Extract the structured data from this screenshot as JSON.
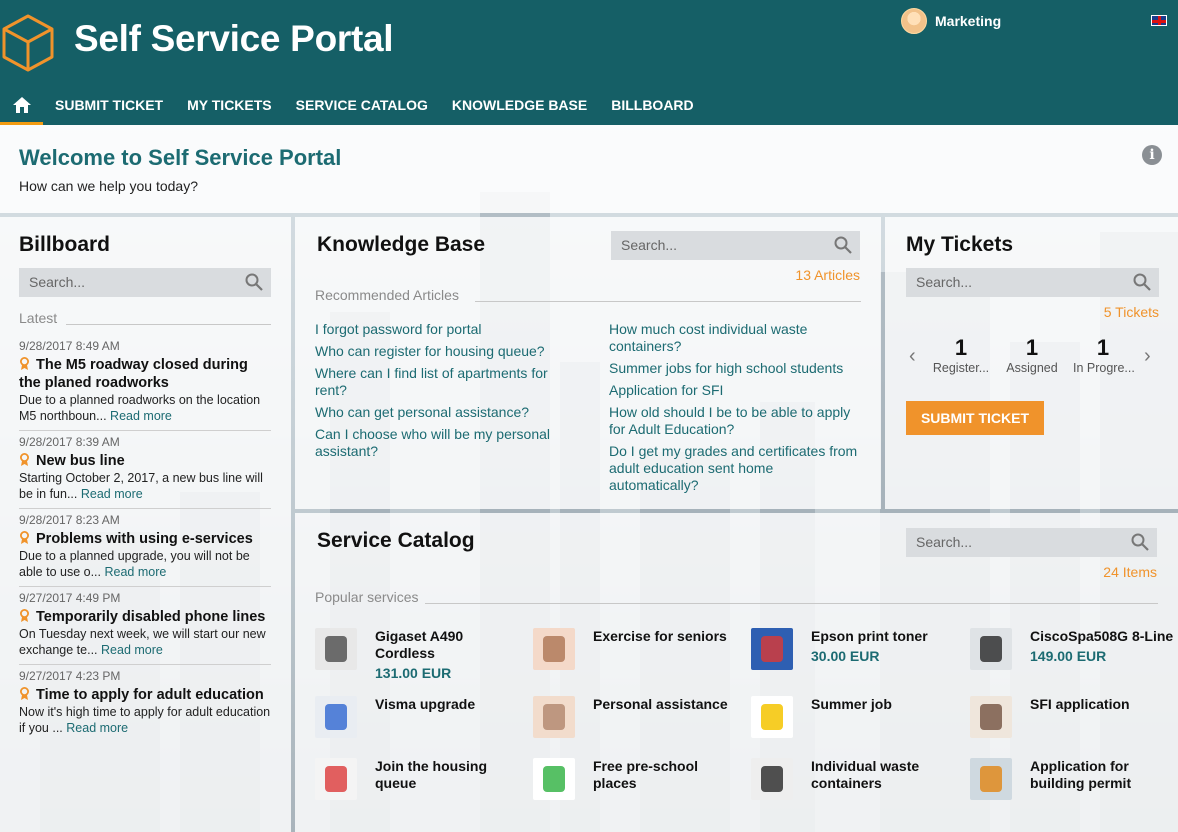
{
  "header": {
    "brand": "Self Service Portal",
    "user_name": "Marketing"
  },
  "nav": {
    "items": [
      "SUBMIT TICKET",
      "MY TICKETS",
      "SERVICE CATALOG",
      "KNOWLEDGE BASE",
      "BILLBOARD"
    ]
  },
  "welcome": {
    "title": "Welcome to Self Service Portal",
    "subtitle": "How can we help you today?"
  },
  "billboard": {
    "title": "Billboard",
    "search_placeholder": "Search...",
    "latest_label": "Latest",
    "read_more": "Read more",
    "items": [
      {
        "date": "9/28/2017 8:49 AM",
        "title": "The M5 roadway closed during the planed roadworks",
        "text": "Due to a planned roadworks on the location M5 northboun..."
      },
      {
        "date": "9/28/2017 8:39 AM",
        "title": "New bus line",
        "text": "Starting October 2, 2017, a new bus line will be in fun..."
      },
      {
        "date": "9/28/2017 8:23 AM",
        "title": "Problems with using e-services",
        "text": "Due to a planned upgrade, you will not be able to use o..."
      },
      {
        "date": "9/27/2017 4:49 PM",
        "title": "Temporarily disabled phone lines",
        "text": "On Tuesday next week, we will start our new exchange te..."
      },
      {
        "date": "9/27/2017 4:23 PM",
        "title": "Time to apply for adult education",
        "text": "Now it's high time to apply for adult education if you ..."
      }
    ]
  },
  "knowledge_base": {
    "title": "Knowledge Base",
    "search_placeholder": "Search...",
    "count": "13 Articles",
    "recommended_label": "Recommended Articles",
    "left_articles": [
      "I forgot password for portal",
      "Who can register for housing queue?",
      "Where can I find list of apartments for rent?",
      "Who can get personal assistance?",
      "Can I choose who will be my personal assistant?"
    ],
    "right_articles": [
      "How much cost individual waste containers?",
      "Summer jobs for high school students",
      "Application for SFI",
      "How old should I be to be able to apply for Adult Education?",
      "Do I get my grades and certificates from adult education sent home automatically?"
    ]
  },
  "my_tickets": {
    "title": "My Tickets",
    "search_placeholder": "Search...",
    "count": "5 Tickets",
    "stats": [
      {
        "value": "1",
        "label": "Register..."
      },
      {
        "value": "1",
        "label": "Assigned"
      },
      {
        "value": "1",
        "label": "In Progre..."
      }
    ],
    "submit_label": "SUBMIT TICKET"
  },
  "service_catalog": {
    "title": "Service Catalog",
    "search_placeholder": "Search...",
    "count": "24 Items",
    "popular_label": "Popular services",
    "services": [
      {
        "name": "Gigaset A490 Cordless",
        "price": "131.00 EUR",
        "icon": "phone-cordless-icon"
      },
      {
        "name": "Exercise for seniors",
        "price": "",
        "icon": "seniors-icon"
      },
      {
        "name": "Epson print toner",
        "price": "30.00 EUR",
        "icon": "toner-icon"
      },
      {
        "name": "CiscoSpa508G 8-Line",
        "price": "149.00 EUR",
        "icon": "desk-phone-icon"
      },
      {
        "name": "Visma upgrade",
        "price": "",
        "icon": "keyboard-icon"
      },
      {
        "name": "Personal assistance",
        "price": "",
        "icon": "handshake-icon"
      },
      {
        "name": "Summer job",
        "price": "",
        "icon": "sun-icon"
      },
      {
        "name": "SFI application",
        "price": "",
        "icon": "writing-icon"
      },
      {
        "name": "Join the housing queue",
        "price": "",
        "icon": "house-icon"
      },
      {
        "name": "Free pre-school places",
        "price": "",
        "icon": "crayons-icon"
      },
      {
        "name": "Individual waste containers",
        "price": "",
        "icon": "bins-icon"
      },
      {
        "name": "Application for building permit",
        "price": "",
        "icon": "builders-icon"
      }
    ]
  }
}
